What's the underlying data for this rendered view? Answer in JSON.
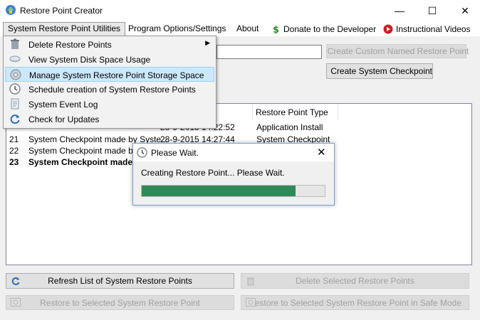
{
  "window": {
    "title": "Restore Point Creator",
    "minimize_glyph": "—",
    "maximize_glyph": "☐",
    "close_glyph": "✕"
  },
  "menu": {
    "utilities": "System Restore Point Utilities",
    "options": "Program Options/Settings",
    "about": "About",
    "donate": "Donate to the Developer",
    "videos": "Instructional Videos"
  },
  "dropdown": {
    "items": [
      {
        "label": "Delete Restore Points",
        "icon": "trash-icon",
        "submenu": true
      },
      {
        "label": "View System Disk Space Usage",
        "icon": "disk-icon"
      },
      {
        "label": "Manage System Restore Point Storage Space",
        "icon": "settings-disk-icon",
        "highlighted": true
      },
      {
        "label": "Schedule creation of System Restore Points",
        "icon": "clock-icon"
      },
      {
        "label": "System Event Log",
        "icon": "log-icon"
      },
      {
        "label": "Check for Updates",
        "icon": "refresh-icon"
      }
    ],
    "submenu_arrow": "▶"
  },
  "controls": {
    "custom_name_value": "",
    "create_custom_named": "Create Custom Named Restore Point",
    "create_checkpoint": "Create System Checkpoint"
  },
  "list": {
    "header_type": "Restore Point Type",
    "rows": [
      {
        "id": "",
        "desc": "",
        "date": "28-9-2015 14:22:52",
        "type": "Application Install"
      },
      {
        "id": "21",
        "desc": "System Checkpoint made by Syste...",
        "date": "28-9-2015 14:27:44",
        "type": "System Checkpoint"
      },
      {
        "id": "22",
        "desc": "System Checkpoint made by Sys",
        "date": "",
        "type": ""
      },
      {
        "id": "23",
        "desc": "System Checkpoint made b",
        "date": "",
        "type": "",
        "bold": true
      }
    ]
  },
  "bottom": {
    "refresh": "Refresh List of System Restore Points",
    "delete_selected": "Delete Selected Restore Points",
    "restore": "Restore to Selected System Restore Point",
    "restore_safe": "Restore to Selected System Restore Point in Safe Mode"
  },
  "dialog": {
    "title": "Please Wait.",
    "message": "Creating Restore Point... Please Wait.",
    "close_glyph": "✕",
    "progress": 0.84
  },
  "colors": {
    "progress": "#2e8b57",
    "highlight": "#cce8ff",
    "disabled_text": "#a0a0a0"
  }
}
